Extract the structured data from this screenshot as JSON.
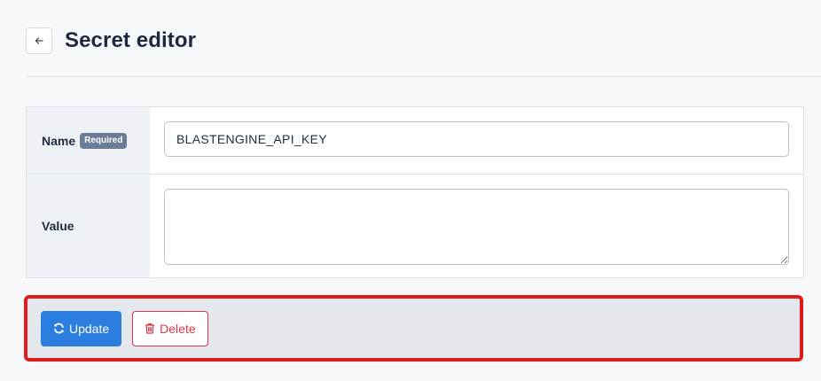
{
  "header": {
    "title": "Secret editor",
    "back_icon": "arrow-left-icon"
  },
  "form": {
    "name": {
      "label": "Name",
      "badge": "Required",
      "value": "BLASTENGINE_API_KEY"
    },
    "value": {
      "label": "Value",
      "value": ""
    }
  },
  "actions": {
    "update_label": "Update",
    "update_icon": "refresh-icon",
    "delete_label": "Delete",
    "delete_icon": "trash-icon"
  },
  "colors": {
    "primary": "#2b7de0",
    "danger": "#d9364a",
    "highlight_border": "#e01b1b",
    "badge": "#6b7d96"
  }
}
